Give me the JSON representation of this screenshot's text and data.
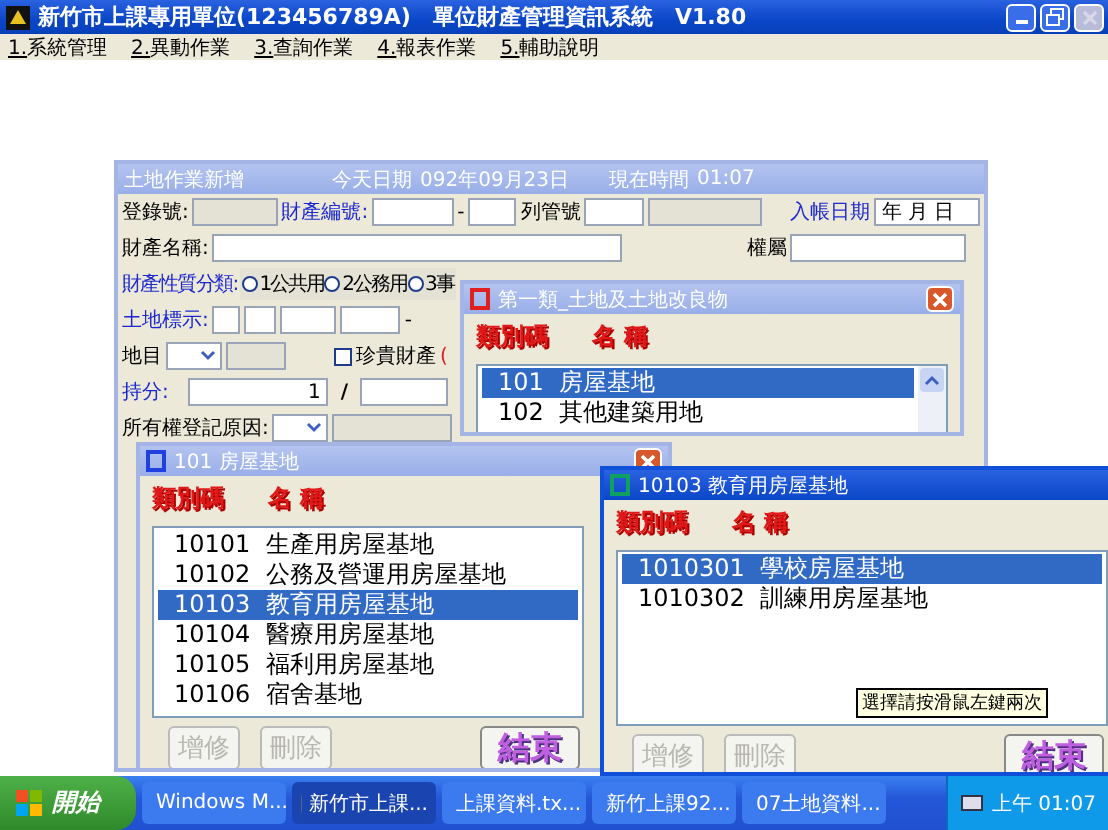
{
  "app": {
    "title": "新竹市上課專用單位(123456789A)　單位財產管理資訊系統　V1.80",
    "menu": [
      "1.系統管理",
      "2.異動作業",
      "3.查詢作業",
      "4.報表作業",
      "5.輔助說明"
    ]
  },
  "form": {
    "title": "土地作業新增",
    "today_label": "今天日期",
    "today": "092年09月23日",
    "time_label": "現在時間",
    "time": "01:07",
    "active": false,
    "reg_no_label": "登錄號:",
    "prop_no_label": "財產編號:",
    "dash": "-",
    "control_no_label": "列管號",
    "entry_date_label": "入帳日期",
    "entry_date_value": "年 月 日",
    "prop_name_label": "財產名稱:",
    "ownership_label": "權屬",
    "category_label": "財產性質分類:",
    "category_options": [
      {
        "label": "1公共用",
        "selected": false
      },
      {
        "label": "2公務用",
        "selected": false
      },
      {
        "label": "3事",
        "selected": false
      }
    ],
    "land_mark_label": "土地標示:",
    "land_mark_dash": "-",
    "land_type_label": "地目",
    "precious": {
      "label": "珍貴財產",
      "checked": false
    },
    "precious_note": "(",
    "share_label": "持分:",
    "share_value": "1",
    "share_sep": "/",
    "reg_reason_label": "所有權登記原因:"
  },
  "picker_windows": [
    {
      "title": "第一類_土地及土地改良物",
      "active": false,
      "color": "#e02020",
      "header": [
        "類別碼",
        "名 稱"
      ],
      "items": [
        {
          "code": "101",
          "name": "房屋基地",
          "selected": true
        },
        {
          "code": "102",
          "name": "其他建築用地",
          "selected": false
        }
      ]
    },
    {
      "title": "101 房屋基地",
      "active": false,
      "color": "#2040e0",
      "header": [
        "類別碼",
        "名 稱"
      ],
      "items": [
        {
          "code": "10101",
          "name": "生產用房屋基地",
          "selected": false
        },
        {
          "code": "10102",
          "name": "公務及營運用房屋基地",
          "selected": false
        },
        {
          "code": "10103",
          "name": "教育用房屋基地",
          "selected": true
        },
        {
          "code": "10104",
          "name": "醫療用房屋基地",
          "selected": false
        },
        {
          "code": "10105",
          "name": "福利用房屋基地",
          "selected": false
        },
        {
          "code": "10106",
          "name": "宿舍基地",
          "selected": false
        }
      ],
      "buttons": [
        {
          "label": "增修",
          "disabled": true,
          "kind": "plain"
        },
        {
          "label": "刪除",
          "disabled": true,
          "kind": "plain"
        },
        {
          "label": "結束",
          "disabled": false,
          "kind": "fancy"
        }
      ]
    },
    {
      "title": "10103 教育用房屋基地",
      "active": true,
      "color": "#10a060",
      "header": [
        "類別碼",
        "名 稱"
      ],
      "items": [
        {
          "code": "1010301",
          "name": "學校房屋基地",
          "selected": true
        },
        {
          "code": "1010302",
          "name": "訓練用房屋基地",
          "selected": false
        }
      ],
      "buttons": [
        {
          "label": "增修",
          "disabled": true,
          "kind": "plain"
        },
        {
          "label": "刪除",
          "disabled": true,
          "kind": "plain"
        },
        {
          "label": "結束",
          "disabled": false,
          "kind": "fancy"
        }
      ],
      "tooltip": "選擇請按滑鼠左鍵兩次"
    }
  ],
  "taskbar": {
    "start": "開始",
    "items": [
      {
        "label": "Windows M...",
        "selected": false
      },
      {
        "label": "新竹市上課...",
        "selected": true
      },
      {
        "label": "上課資料.tx...",
        "selected": false
      },
      {
        "label": "新竹上課92...",
        "selected": false
      },
      {
        "label": "07土地資料...",
        "selected": false
      }
    ],
    "clock": "上午 01:07"
  }
}
